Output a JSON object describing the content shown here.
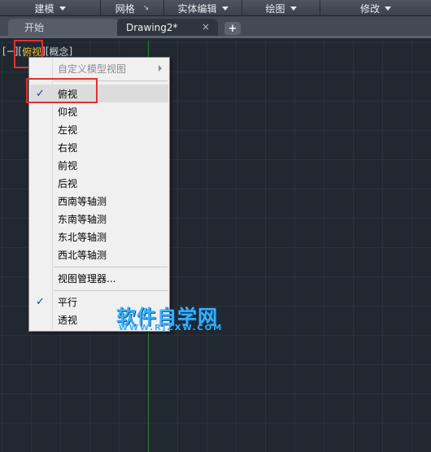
{
  "ribbon": {
    "panels": [
      {
        "label": "建模",
        "dropdown": true
      },
      {
        "label": "网格",
        "dropdown": false
      },
      {
        "label": "实体编辑",
        "dropdown": true
      },
      {
        "label": "绘图",
        "dropdown": true
      },
      {
        "label": "修改",
        "dropdown": true
      }
    ]
  },
  "tabs": {
    "start_label": "开始",
    "drawing_label": "Drawing2*",
    "close_glyph": "×",
    "add_glyph": "+"
  },
  "viewport": {
    "open": "[−][",
    "view": "俯视",
    "mid": "][",
    "style": "概念",
    "close": "]"
  },
  "menu": {
    "items": [
      {
        "label": "自定义模型视图",
        "disabled": true,
        "submenu": true,
        "checked": false
      },
      {
        "label": "俯视",
        "checked": true,
        "selected": true
      },
      {
        "label": "仰视",
        "checked": false
      },
      {
        "label": "左视",
        "checked": false
      },
      {
        "label": "右视",
        "checked": false
      },
      {
        "label": "前视",
        "checked": false
      },
      {
        "label": "后视",
        "checked": false
      },
      {
        "label": "西南等轴测",
        "checked": false
      },
      {
        "label": "东南等轴测",
        "checked": false
      },
      {
        "label": "东北等轴测",
        "checked": false
      },
      {
        "label": "西北等轴测",
        "checked": false
      },
      {
        "label": "视图管理器...",
        "checked": false
      },
      {
        "label": "平行",
        "checked": true
      },
      {
        "label": "透视",
        "checked": false
      }
    ],
    "check_glyph": "✓"
  },
  "watermark": {
    "main": "软件自学网",
    "sub": "WWW.RJZXW.COM"
  },
  "colors": {
    "canvas_bg": "#212830",
    "active_view": "#f2c335",
    "highlight": "#e23131",
    "watermark": "#37b1ff"
  }
}
